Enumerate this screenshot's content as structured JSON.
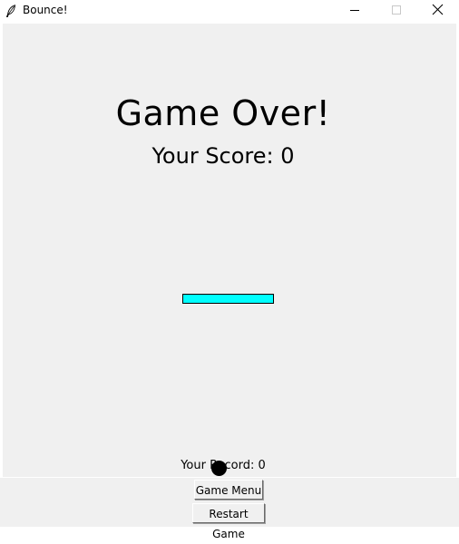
{
  "window": {
    "title": "Bounce!"
  },
  "game": {
    "game_over_text": "Game Over!",
    "score_text": "Your Score: 0",
    "record_text": "Your Record: 0",
    "score": 0,
    "record": 0,
    "paddle_color": "#00ffff",
    "ball_color": "#000000",
    "background_color": "#f0f0f0"
  },
  "controls": {
    "menu_label": "Game Menu",
    "restart_label": "Restart Game"
  },
  "icons": {
    "app": "feather-icon",
    "minimize": "minimize-icon",
    "maximize": "maximize-icon",
    "close": "close-icon"
  }
}
